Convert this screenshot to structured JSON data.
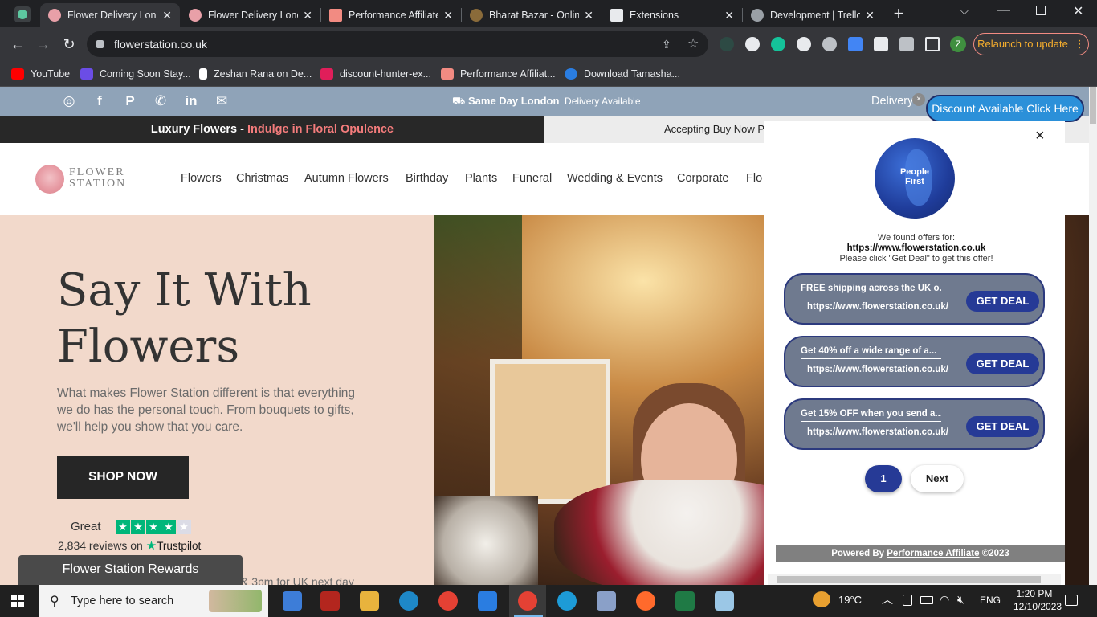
{
  "browser": {
    "tabs": [
      {
        "title": "Flower Delivery Lond",
        "active": true
      },
      {
        "title": "Flower Delivery Lond",
        "active": false
      },
      {
        "title": "Performance Affiliate",
        "active": false
      },
      {
        "title": "Bharat Bazar - Online",
        "active": false
      },
      {
        "title": "Extensions",
        "active": false
      },
      {
        "title": "Development | Trello",
        "active": false
      }
    ],
    "new_tab": "+",
    "url": "flowerstation.co.uk",
    "relaunch_label": "Relaunch to update",
    "profile_initial": "Z",
    "bookmarks": [
      {
        "label": "YouTube",
        "color": "#ff0000"
      },
      {
        "label": "Coming Soon Stay...",
        "color": "#6b4de6"
      },
      {
        "label": "Zeshan Rana on De...",
        "color": "#ffffff"
      },
      {
        "label": "discount-hunter-ex...",
        "color": "#e01e5a"
      },
      {
        "label": "Performance Affiliat...",
        "color": "#f28b82"
      },
      {
        "label": "Download Tamasha...",
        "color": "#2a7de1"
      }
    ]
  },
  "site": {
    "topbar": {
      "same_day": "Same Day London",
      "delivery_available": "Delivery Available",
      "right_text": "Delivery",
      "discount_button": "Discount Available Click Here"
    },
    "promo": {
      "left_bold": "Luxury Flowers - ",
      "left_accent": "Indulge in Floral Opulence",
      "right_text": "Accepting Buy Now Pa"
    },
    "logo": {
      "line1": "FLOWER",
      "line2": "STATION"
    },
    "nav": [
      "Flowers",
      "Christmas",
      "Autumn Flowers",
      "Birthday",
      "Plants",
      "Funeral",
      "Wedding & Events",
      "Corporate",
      "Flo"
    ],
    "hero": {
      "title_line1": "Say It With",
      "title_line2": "Flowers",
      "body": "What makes Flower Station different is that everything we do has the personal touch. From bouquets to gifts, we'll help you show that you care.",
      "cta": "SHOP NOW",
      "rating_word": "Great",
      "stars_filled": 4.5,
      "reviews": "2,834 reviews on",
      "trustpilot": "Trustpilot",
      "cutoff_text": "& 3pm for UK next day"
    },
    "rewards_label": "Flower Station Rewards"
  },
  "popup": {
    "close": "×",
    "badge_line1": "People",
    "badge_line2": "First",
    "found_text": "We found offers for:",
    "found_url": "https://www.flowerstation.co.uk",
    "instruction": "Please click \"Get Deal\" to get this offer!",
    "deals": [
      {
        "title": "FREE shipping across the UK o...",
        "url": "https://www.flowerstation.co.uk/",
        "button": "GET DEAL"
      },
      {
        "title": "Get 40% off a wide range of a...",
        "url": "https://www.flowerstation.co.uk/",
        "button": "GET DEAL"
      },
      {
        "title": "Get 15% OFF when you send a...",
        "url": "https://www.flowerstation.co.uk/",
        "button": "GET DEAL"
      }
    ],
    "pagination": {
      "current": "1",
      "next": "Next"
    },
    "footer_prefix": "Powered By ",
    "footer_link": "Performance Affiliate",
    "footer_suffix": " ©2023"
  },
  "taskbar": {
    "search_placeholder": "Type here to search",
    "temperature": "19°C",
    "language": "ENG",
    "time": "1:20 PM",
    "date": "12/10/2023"
  },
  "colors": {
    "tab_bg": "#202124",
    "toolbar_bg": "#35363a",
    "topbar_bg": "#8fa3b8",
    "hero_bg": "#f2d9cb",
    "accent_pink": "#f47c7c",
    "deal_bg": "#6f7a8f",
    "deal_button": "#263a96",
    "discount_button": "#2b90d9"
  }
}
